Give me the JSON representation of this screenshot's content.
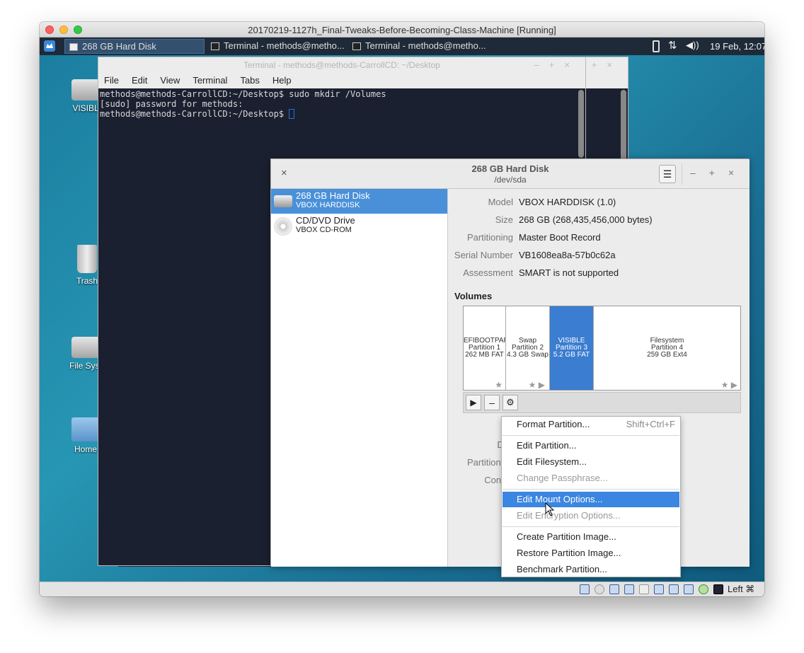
{
  "mac": {
    "title": "20170219-1127h_Final-Tweaks-Before-Becoming-Class-Machine [Running]"
  },
  "panel": {
    "tasks": [
      "268 GB Hard Disk",
      "Terminal - methods@metho...",
      "Terminal - methods@metho..."
    ],
    "datetime": "19 Feb, 12:07"
  },
  "desktop": {
    "icons": [
      "VISIBL",
      "Trash",
      "File Syst",
      "Home"
    ]
  },
  "terminal": {
    "title": "Terminal - methods@methods-CarrollCD: ~/Desktop",
    "menu": [
      "File",
      "Edit",
      "View",
      "Terminal",
      "Tabs",
      "Help"
    ],
    "lines": [
      "methods@methods-CarrollCD:~/Desktop$ sudo mkdir /Volumes",
      "[sudo] password for methods:",
      "methods@methods-CarrollCD:~/Desktop$ "
    ]
  },
  "disks": {
    "title": "268 GB Hard Disk",
    "subtitle": "/dev/sda",
    "devices": [
      {
        "name": "268 GB Hard Disk",
        "sub": "VBOX HARDDISK"
      },
      {
        "name": "CD/DVD Drive",
        "sub": "VBOX CD-ROM"
      }
    ],
    "props": [
      {
        "label": "Model",
        "value": "VBOX HARDDISK (1.0)"
      },
      {
        "label": "Size",
        "value": "268 GB (268,435,456,000 bytes)"
      },
      {
        "label": "Partitioning",
        "value": "Master Boot Record"
      },
      {
        "label": "Serial Number",
        "value": "VB1608ea8a-57b0c62a"
      },
      {
        "label": "Assessment",
        "value": "SMART is not supported"
      }
    ],
    "volumes_heading": "Volumes",
    "volumes": [
      {
        "l1": "EFIBOOTPART",
        "l2": "Partition 1",
        "l3": "262 MB FAT"
      },
      {
        "l1": "Swap",
        "l2": "Partition 2",
        "l3": "4.3 GB Swap"
      },
      {
        "l1": "VISIBLE",
        "l2": "Partition 3",
        "l3": "5.2 GB FAT"
      },
      {
        "l1": "Filesystem",
        "l2": "Partition 4",
        "l3": "259 GB Ext4"
      }
    ],
    "hidden_labels": [
      "De",
      "Partition T",
      "Conte"
    ]
  },
  "context_menu": [
    {
      "label": "Format Partition...",
      "accel": "Shift+Ctrl+F"
    },
    {
      "label": "Edit Partition..."
    },
    {
      "label": "Edit Filesystem..."
    },
    {
      "label": "Change Passphrase..."
    },
    {
      "label": "Edit Mount Options..."
    },
    {
      "label": "Edit Encryption Options..."
    },
    {
      "label": "Create Partition Image..."
    },
    {
      "label": "Restore Partition Image..."
    },
    {
      "label": "Benchmark Partition..."
    }
  ],
  "vbox": {
    "host_key": "Left ⌘"
  }
}
